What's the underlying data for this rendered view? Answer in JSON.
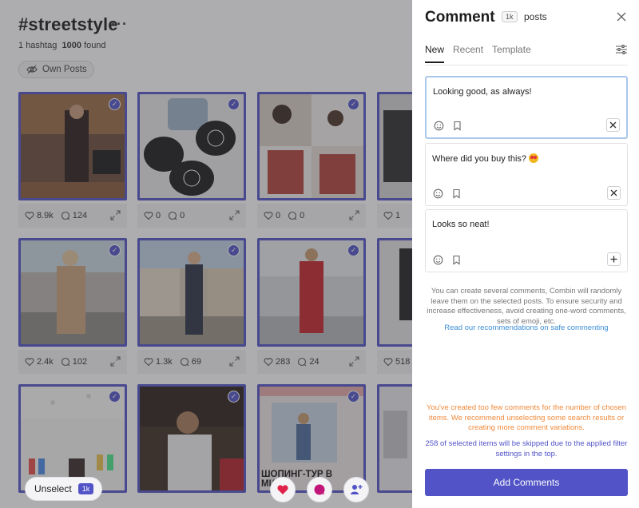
{
  "feed": {
    "hashtag_title": "#streetstyle",
    "more_glyph": "···",
    "hashtag_count": "1",
    "hashtag_label": "hashtag",
    "found_count": "1000",
    "found_label": "found",
    "own_posts_label": "Own Posts",
    "posts": [
      {
        "likes": "8.9k",
        "comments": "124"
      },
      {
        "likes": "0",
        "comments": "0"
      },
      {
        "likes": "0",
        "comments": "0"
      },
      {
        "likes": "1",
        "comments": ""
      },
      {
        "likes": "2.4k",
        "comments": "102"
      },
      {
        "likes": "1.3k",
        "comments": "69"
      },
      {
        "likes": "283",
        "comments": "24"
      },
      {
        "likes": "518",
        "comments": ""
      },
      {
        "likes": "",
        "comments": ""
      },
      {
        "likes": "",
        "comments": ""
      },
      {
        "likes": "",
        "comments": ""
      },
      {
        "likes": "",
        "comments": ""
      }
    ],
    "post_9_caption": "ШОПИНГ-ТУР В МИ...Ч",
    "unselect_label": "Unselect",
    "unselect_badge": "1k",
    "accent_color": "#5153c6"
  },
  "panel": {
    "title": "Comment",
    "posts_badge": "1k",
    "posts_label": "posts",
    "tabs": [
      "New",
      "Recent",
      "Template"
    ],
    "active_tab": "New",
    "comments": [
      {
        "text": "Looking good, as always!",
        "action": "remove"
      },
      {
        "text": "Where did you buy this?",
        "action": "remove"
      },
      {
        "text": "Looks so neat!",
        "action": "add"
      }
    ],
    "info_text": "You can create several comments, Combin will randomly leave them on the selected posts. To ensure security and increase effectiveness, avoid creating one-word comments, sets of emoji, etc.",
    "info_link": "Read our recommendations on safe commenting",
    "warning_text": "You've created too few comments for the number of chosen items. We recommend unselecting some search results or creating more comment variations.",
    "skip_text": "258 of selected items will be skipped due to the applied filter settings in the top.",
    "add_button": "Add Comments",
    "colors": {
      "primary": "#5153c6",
      "warning": "#f08a3c",
      "link": "#3d8fd6"
    }
  }
}
